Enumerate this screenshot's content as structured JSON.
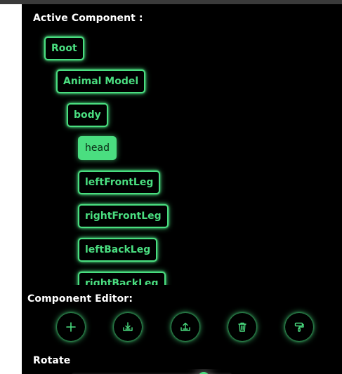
{
  "active_component_label": "Active Component :",
  "tree": [
    {
      "label": "Root"
    },
    {
      "label": "Animal Model"
    },
    {
      "label": "body"
    },
    {
      "label": "head",
      "active": true
    },
    {
      "label": "leftFrontLeg"
    },
    {
      "label": "rightFrontLeg"
    },
    {
      "label": "leftBackLeg"
    },
    {
      "label": "rightBackLeg"
    }
  ],
  "editor": {
    "title": "Component Editor:",
    "buttons": [
      {
        "icon": "plus-icon"
      },
      {
        "icon": "download-tray-icon"
      },
      {
        "icon": "upload-tray-icon"
      },
      {
        "icon": "trash-icon"
      },
      {
        "icon": "paint-roller-icon"
      }
    ]
  },
  "rotate_label": "Rotate",
  "colors": {
    "accent": "#4ade80",
    "background": "#000000",
    "text": "#ffffff"
  }
}
